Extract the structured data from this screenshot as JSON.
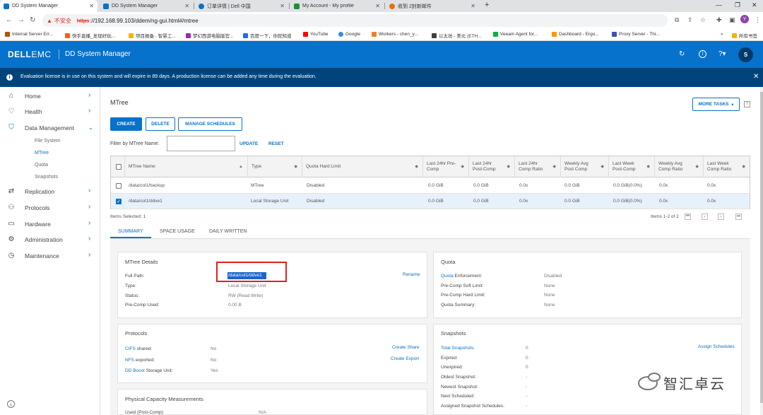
{
  "browser": {
    "tabs": [
      {
        "title": "DD System Manager",
        "active": true,
        "color": "#0672cb"
      },
      {
        "title": "DD System Manager",
        "active": false,
        "color": "#0672cb"
      },
      {
        "title": "订单详情 | Dell 中国",
        "active": false,
        "color": "#0672cb"
      },
      {
        "title": "My Account - My profile",
        "active": false,
        "color": "#1e8e3e"
      },
      {
        "title": "收到 2封新邮件",
        "active": false,
        "color": "#e8710a"
      }
    ],
    "url": {
      "warning_label": "不安全",
      "protocol": "https",
      "rest": "://192.168.99.103/ddem/ng-gui.html#/mtree"
    },
    "profile_initial": "Y",
    "bookmarks": [
      "Internal Server Err...",
      "快手直播_发现好玩...",
      "项目报备 - 智慧工...",
      "梦幻西游电脑版官...",
      "百度一下，你就知道",
      "YouTube",
      "Google",
      "Workers - chen_y...",
      "以太坊 - 美元 (ETH...",
      "Veeam Agent for...",
      "Dashboard - Ergo...",
      "Proxy Server - Thi..."
    ],
    "all_bookmarks": "所有书签"
  },
  "app": {
    "logo_dell": "DELL",
    "logo_emc": "EMC",
    "title": "DD System Manager",
    "user_initial": "S",
    "banner": "Evaluation license is in use on this system and will expire in 89 days. A production license can be added any time during the evaluation."
  },
  "sidebar": {
    "items": [
      {
        "label": "Home",
        "icon": "home-icon"
      },
      {
        "label": "Health",
        "icon": "heart-icon"
      },
      {
        "label": "Data Management",
        "icon": "shield-icon"
      },
      {
        "label": "Replication",
        "icon": "replication-icon"
      },
      {
        "label": "Protocols",
        "icon": "protocols-icon"
      },
      {
        "label": "Hardware",
        "icon": "hardware-icon"
      },
      {
        "label": "Administration",
        "icon": "admin-icon"
      },
      {
        "label": "Maintenance",
        "icon": "clock-icon"
      }
    ],
    "sub_items": [
      "File System",
      "MTree",
      "Quota",
      "Snapshots"
    ]
  },
  "page": {
    "title": "MTree",
    "more_tasks": "MORE TASKS",
    "buttons": {
      "create": "CREATE",
      "delete": "DELETE",
      "schedules": "MANAGE SCHEDULES"
    },
    "filter_label": "Filter by MTree Name:",
    "filter_value": "",
    "update": "UPDATE",
    "reset": "RESET"
  },
  "table": {
    "columns": [
      "MTree Name",
      "Type",
      "Quota Hard Limit",
      "Last 24hr Pre-Comp",
      "Last 24hr Post-Comp",
      "Last 24hr Comp Ratio",
      "Weekly Avg Post Comp",
      "Last Week Post-Comp",
      "Weekly Avg Comp Ratio",
      "Last Week Comp Ratio"
    ],
    "rows": [
      {
        "selected": false,
        "cells": [
          "/data/col1/backup",
          "MTree",
          "Disabled",
          "0.0 GiB",
          "0.0 GiB",
          "0.0x",
          "0.0 GiB",
          "0.0 GiB(0.0%)",
          "0.0x",
          "0.0x"
        ]
      },
      {
        "selected": true,
        "cells": [
          "/data/col1/ddve1",
          "Local Storage Unit",
          "Disabled",
          "0.0 GiB",
          "0.0 GiB",
          "0.0x",
          "0.0 GiB",
          "0.0 GiB(0.0%)",
          "0.0x",
          "0.0x"
        ]
      }
    ],
    "selected_info": "Items Selected: 1",
    "items_info": "Items 1-2 of 2"
  },
  "subtabs": [
    "SUMMARY",
    "SPACE USAGE",
    "DAILY WRITTEN"
  ],
  "details": {
    "title": "MTree Details",
    "rename": "Rename",
    "full_path_label": "Full Path:",
    "full_path": "/data/col1/ddve1",
    "type_label": "Type:",
    "type": "Local Storage Unit",
    "status_label": "Status:",
    "status": "RW (Read Write)",
    "precomp_label": "Pre-Comp Used:",
    "precomp": "0.00 B"
  },
  "quota": {
    "title": "Quota",
    "enforcement_link": "Quota",
    "enforcement_label": " Enforcement:",
    "enforcement": "Disabled",
    "soft_label": "Pre-Comp Soft Limit:",
    "soft": "None",
    "hard_label": "Pre-Comp Hard Limit:",
    "hard": "None",
    "summary_label": "Quota Summary:",
    "summary": "None"
  },
  "protocols": {
    "title": "Protocols",
    "cifs_link": "CIFS",
    "cifs_label": " shared:",
    "cifs": "No",
    "create_share": "Create Share",
    "nfs_link": "NFS",
    "nfs_label": " exported:",
    "nfs": "No",
    "create_export": "Create Export",
    "ddboost_link": "DD Boost",
    "ddboost_label": " Storage Unit:",
    "ddboost": "Yes"
  },
  "snapshots": {
    "title": "Snapshots",
    "assign": "Assign Schedules",
    "rows": [
      {
        "label": "Total Snapshots:",
        "value": "0",
        "link": true
      },
      {
        "label": "Expired:",
        "value": "0",
        "link": false
      },
      {
        "label": "Unexpired:",
        "value": "0",
        "link": false
      },
      {
        "label": "Oldest Snapshot:",
        "value": "-",
        "link": false
      },
      {
        "label": "Newest Snapshot:",
        "value": "-",
        "link": false
      },
      {
        "label": "Next Scheduled:",
        "value": "-",
        "link": false
      },
      {
        "label": "Assigned Snapshot Schedules:",
        "value": "-",
        "link": false
      }
    ]
  },
  "capacity": {
    "title": "Physical Capacity Measurements",
    "used_label": "Used (Post-Comp):",
    "used": "N/A"
  },
  "watermark": "智汇卓云"
}
